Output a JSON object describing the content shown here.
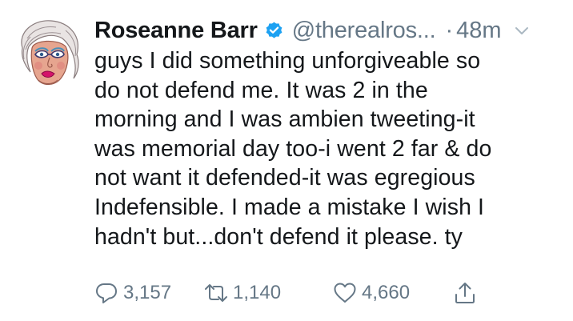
{
  "tweet": {
    "author": {
      "name": "Roseanne Barr",
      "handle": "@therealros...",
      "verified": true
    },
    "separator": "·",
    "time": "48m",
    "text_lines": [
      "guys I did something unforgiveable so",
      "do not defend me. It was 2 in the",
      "morning and I was ambien tweeting-it",
      "was memorial day too-i went 2 far & do",
      "not want it defended-it was egregious",
      "Indefensible. I made a mistake I wish I",
      "hadn't but...don't defend it please. ty"
    ],
    "actions": {
      "reply_count": "3,157",
      "retweet_count": "1,140",
      "like_count": "4,660"
    }
  },
  "icons": {
    "verified": "verified-badge-icon",
    "caret": "chevron-down-icon",
    "reply": "reply-icon",
    "retweet": "retweet-icon",
    "like": "heart-icon",
    "share": "share-icon"
  },
  "colors": {
    "text": "#14171a",
    "secondary": "#657786",
    "verified": "#1da1f2"
  }
}
